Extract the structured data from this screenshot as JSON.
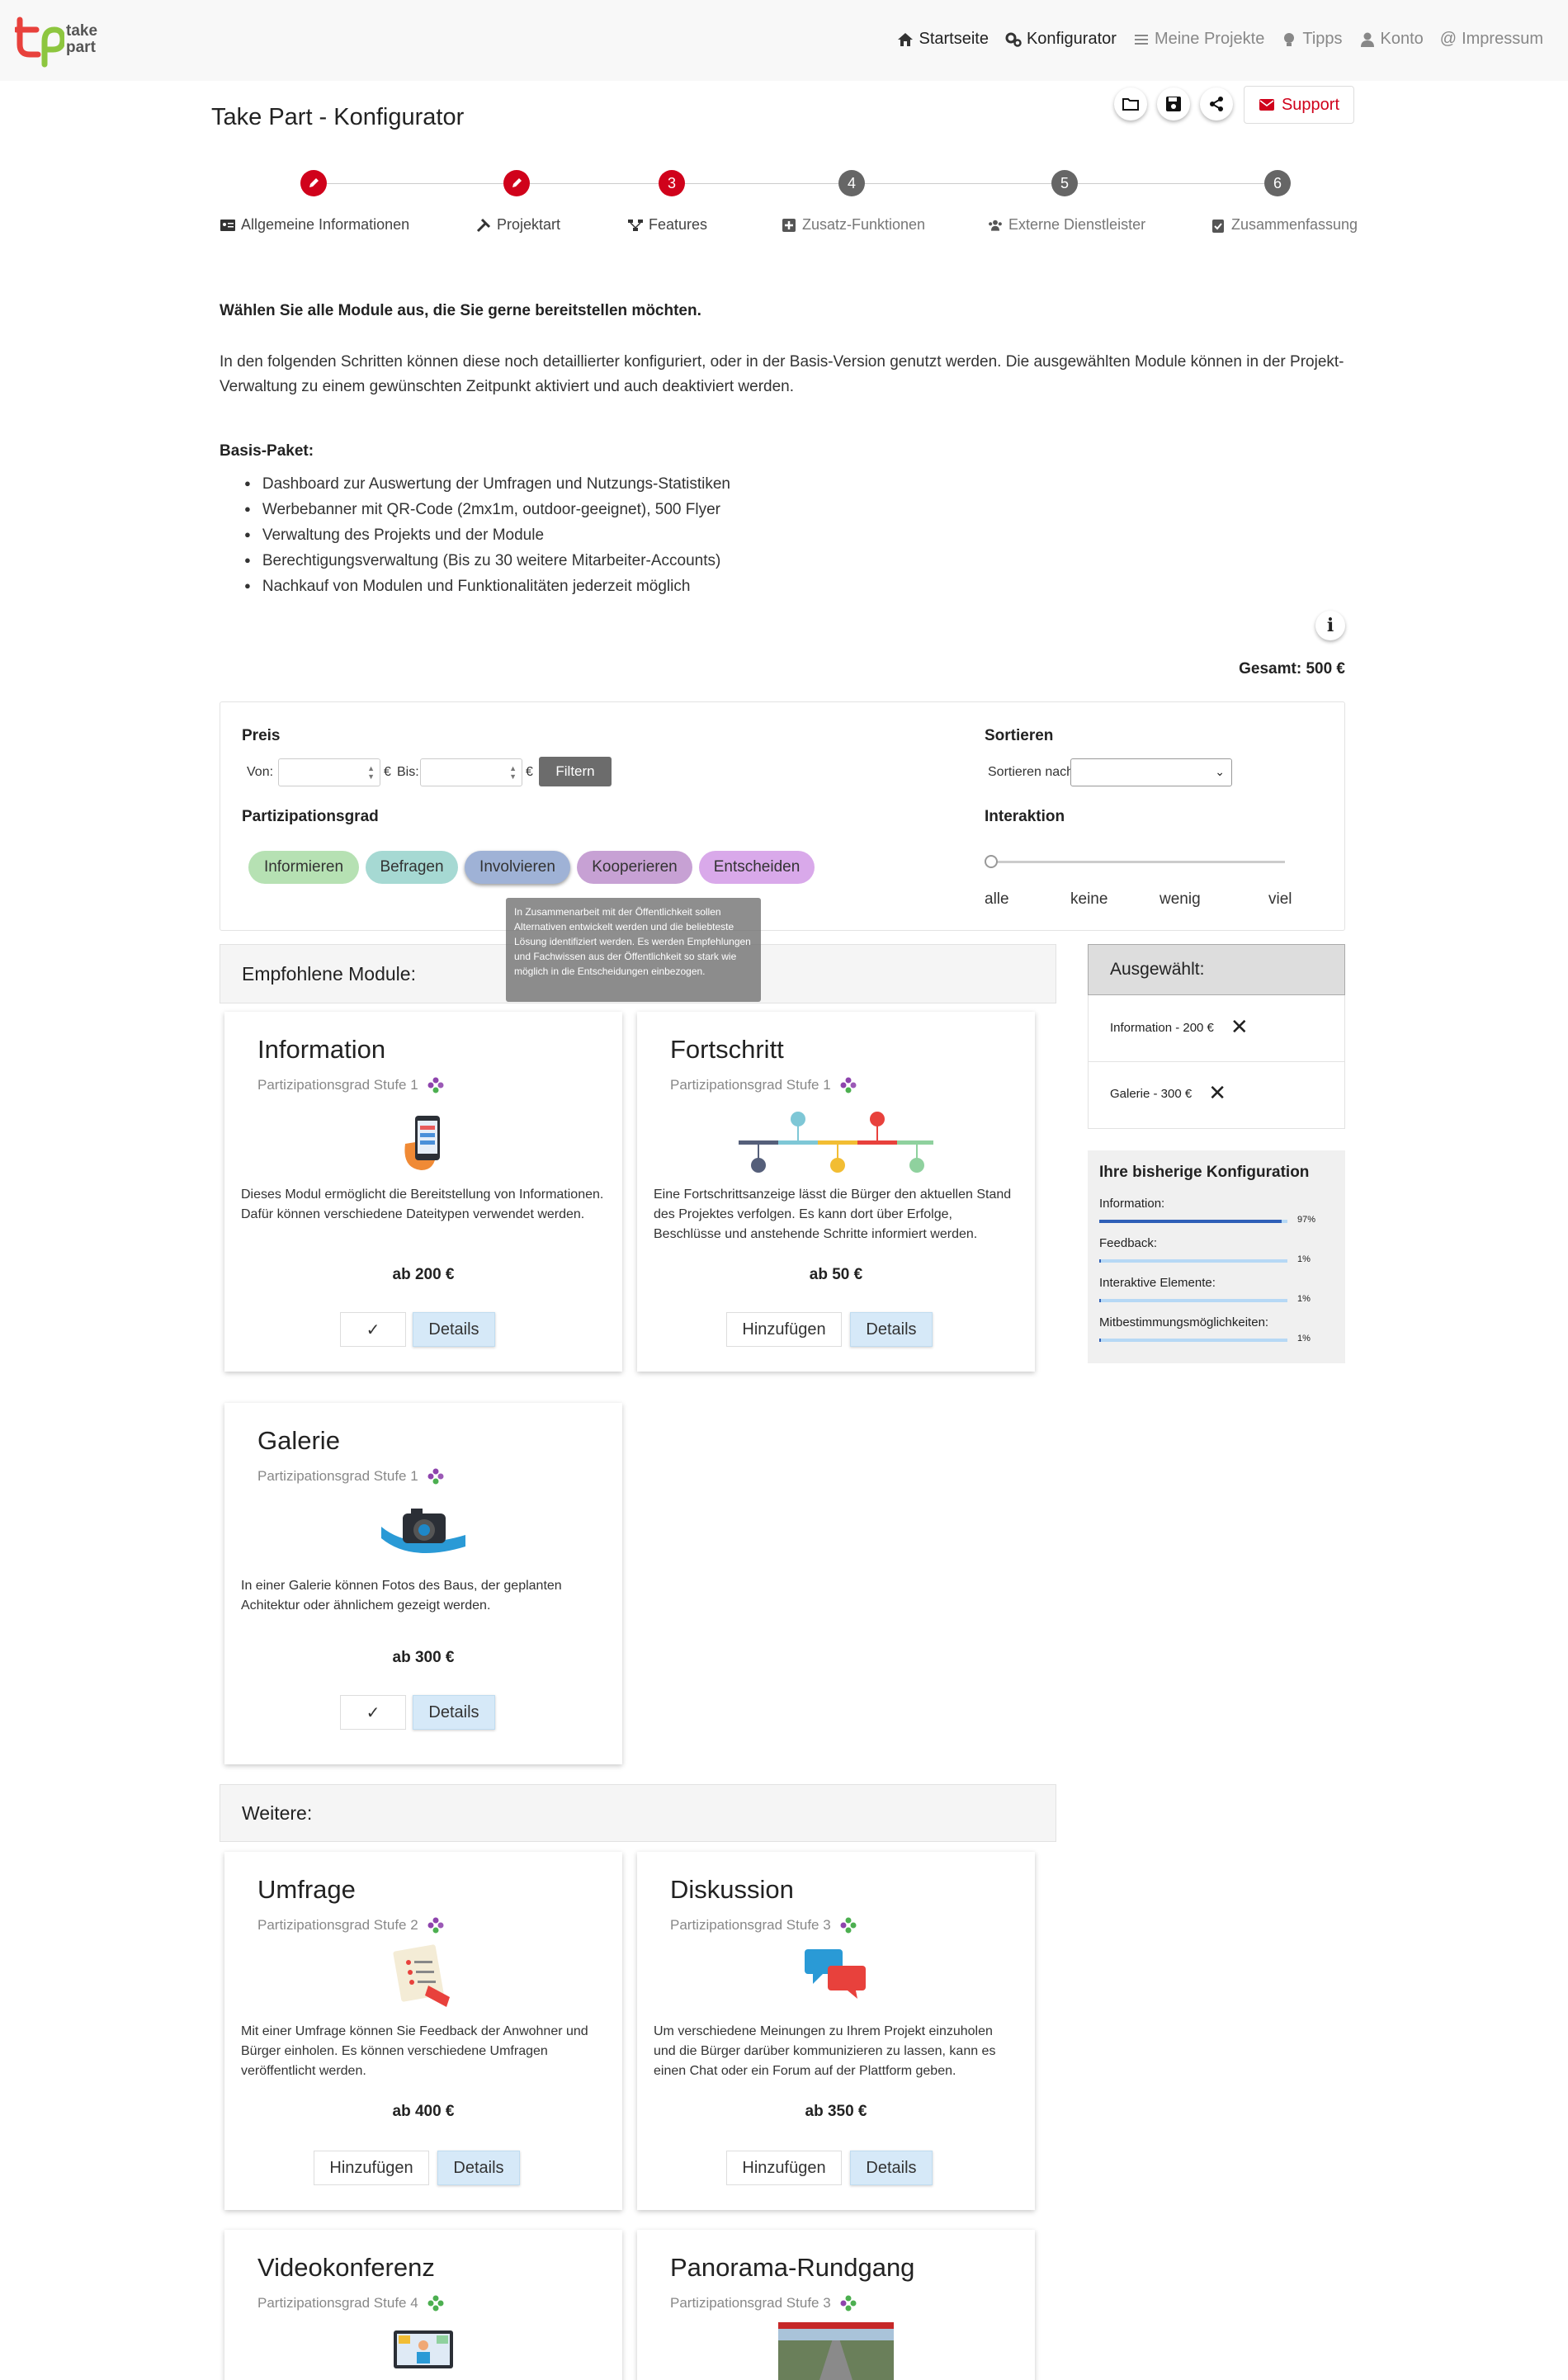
{
  "nav": {
    "logo_text": "take\npart",
    "items": [
      {
        "label": "Startseite",
        "icon": "home-icon",
        "active": true
      },
      {
        "label": "Konfigurator",
        "icon": "gears-icon",
        "active": true
      },
      {
        "label": "Meine Projekte",
        "icon": "list-icon",
        "active": false
      },
      {
        "label": "Tipps",
        "icon": "lightbulb-icon",
        "active": false
      },
      {
        "label": "Konto",
        "icon": "user-icon",
        "active": false
      },
      {
        "label": "Impressum",
        "icon": "at-icon",
        "active": false
      }
    ]
  },
  "page_title": "Take Part - Konfigurator",
  "support_label": "Support",
  "steps": [
    {
      "number": "",
      "label": "Allgemeine Informationen",
      "state": "done",
      "icon": "id-card-icon"
    },
    {
      "number": "",
      "label": "Projektart",
      "state": "done",
      "icon": "tools-icon"
    },
    {
      "number": "3",
      "label": "Features",
      "state": "current",
      "icon": "sitemap-icon"
    },
    {
      "number": "4",
      "label": "Zusatz-Funktionen",
      "state": "todo",
      "icon": "plus-square-icon"
    },
    {
      "number": "5",
      "label": "Externe Dienstleister",
      "state": "todo",
      "icon": "users-icon"
    },
    {
      "number": "6",
      "label": "Zusammenfassung",
      "state": "todo",
      "icon": "clipboard-check-icon"
    }
  ],
  "intro": {
    "heading": "Wählen Sie alle Module aus, die Sie gerne bereitstellen möchten.",
    "text": "In den folgenden Schritten können diese noch detaillierter konfiguriert, oder in der Basis-Version genutzt werden. Die ausgewählten Module können in der Projekt-Verwaltung zu einem gewünschten Zeitpunkt aktiviert und auch deaktiviert werden."
  },
  "basis": {
    "title": "Basis-Paket:",
    "items": [
      "Dashboard zur Auswertung der Umfragen und Nutzungs-Statistiken",
      "Werbebanner mit QR-Code (2mx1m, outdoor-geeignet), 500 Flyer",
      "Verwaltung des Projekts und der Module",
      "Berechtigungsverwaltung (Bis zu 30 weitere Mitarbeiter-Accounts)",
      "Nachkauf von Modulen und Funktionalitäten jederzeit möglich"
    ]
  },
  "gesamt": "Gesamt: 500 €",
  "filter": {
    "preis_label": "Preis",
    "von_label": "Von:",
    "bis_label": "Bis:",
    "currency": "€",
    "filter_btn": "Filtern",
    "sortieren_label": "Sortieren",
    "sortieren_nach": "Sortieren nach:",
    "partizipation_label": "Partizipationsgrad",
    "pills": [
      {
        "label": "Informieren",
        "color": "#b6e1b3"
      },
      {
        "label": "Befragen",
        "color": "#a6d9d3"
      },
      {
        "label": "Involvieren",
        "color": "#9fb2d6"
      },
      {
        "label": "Kooperieren",
        "color": "#c7a1d4"
      },
      {
        "label": "Entscheiden",
        "color": "#d9a9ea"
      }
    ],
    "interaktion_label": "Interaktion",
    "interaktion_ticks": [
      "alle",
      "keine",
      "wenig",
      "viel"
    ]
  },
  "tooltip": "In Zusammenarbeit mit der Öffentlichkeit sollen Alternativen entwickelt werden und die beliebteste Lösung identifiziert werden. Es werden Empfehlungen und Fachwissen aus der Öffentlichkeit so stark wie möglich in die Entscheidungen einbezogen.",
  "sections": {
    "empfohlen": "Empfohlene Module:",
    "weitere": "Weitere:"
  },
  "modules": {
    "information": {
      "title": "Information",
      "stufe": "Partizipationsgrad Stufe 1",
      "desc": "Dieses Modul ermöglicht die Bereitstellung von Informationen. Dafür können verschiedene Dateitypen verwendet werden.",
      "price": "ab 200 €",
      "action": "✓",
      "details": "Details"
    },
    "fortschritt": {
      "title": "Fortschritt",
      "stufe": "Partizipationsgrad Stufe 1",
      "desc": "Eine Fortschrittsanzeige lässt die Bürger den aktuellen Stand des Projektes verfolgen. Es kann dort über Erfolge, Beschlüsse und anstehende Schritte informiert werden.",
      "price": "ab 50 €",
      "action": "Hinzufügen",
      "details": "Details"
    },
    "galerie": {
      "title": "Galerie",
      "stufe": "Partizipationsgrad Stufe 1",
      "desc": "In einer Galerie können Fotos des Baus, der geplanten Achitektur oder ähnlichem gezeigt werden.",
      "price": "ab 300 €",
      "action": "✓",
      "details": "Details"
    },
    "umfrage": {
      "title": "Umfrage",
      "stufe": "Partizipationsgrad Stufe 2",
      "desc": "Mit einer Umfrage können Sie Feedback der Anwohner und Bürger einholen. Es können verschiedene Umfragen veröffentlicht werden.",
      "price": "ab 400 €",
      "action": "Hinzufügen",
      "details": "Details"
    },
    "diskussion": {
      "title": "Diskussion",
      "stufe": "Partizipationsgrad Stufe 3",
      "desc": "Um verschiedene Meinungen zu Ihrem Projekt einzuholen und die Bürger darüber kommunizieren zu lassen, kann es einen Chat oder ein Forum auf der Plattform geben.",
      "price": "ab 350 €",
      "action": "Hinzufügen",
      "details": "Details"
    },
    "videokonferenz": {
      "title": "Videokonferenz",
      "stufe": "Partizipationsgrad Stufe 4"
    },
    "panorama": {
      "title": "Panorama-Rundgang",
      "stufe": "Partizipationsgrad Stufe 3"
    }
  },
  "selected": {
    "title": "Ausgewählt:",
    "items": [
      "Information - 200 €",
      "Galerie - 300 €"
    ]
  },
  "konfiguration": {
    "title": "Ihre bisherige Konfiguration",
    "rows": [
      {
        "label": "Information:",
        "pct": "97%",
        "value": 0.97
      },
      {
        "label": "Feedback:",
        "pct": "1%",
        "value": 0.01
      },
      {
        "label": "Interaktive Elemente:",
        "pct": "1%",
        "value": 0.01
      },
      {
        "label": "Mitbestimmungsmöglichkeiten:",
        "pct": "1%",
        "value": 0.01
      }
    ]
  }
}
